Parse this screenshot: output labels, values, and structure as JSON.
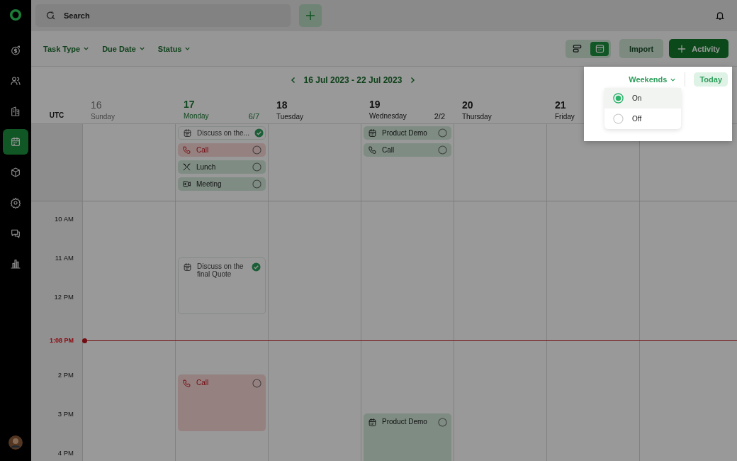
{
  "sidebar": {
    "items": [
      {
        "kind": "deals",
        "selected": false
      },
      {
        "kind": "contacts",
        "selected": false
      },
      {
        "kind": "companies",
        "selected": false
      },
      {
        "kind": "calendar",
        "selected": true
      },
      {
        "kind": "products",
        "selected": false
      },
      {
        "kind": "settings",
        "selected": false
      },
      {
        "kind": "chat",
        "selected": false
      },
      {
        "kind": "reports",
        "selected": false
      }
    ]
  },
  "topbar": {
    "search": {
      "placeholder": "Search"
    }
  },
  "filters": [
    "Task Type",
    "Due Date",
    "Status"
  ],
  "view_toggle": [
    {
      "kind": "list",
      "selected": false
    },
    {
      "kind": "calendar",
      "selected": true
    }
  ],
  "buttons": {
    "import": "Import",
    "activity": "Activity"
  },
  "calendar": {
    "range": "16 Jul 2023 - 22 Jul 2023",
    "timezone": "UTC",
    "days": [
      {
        "date": "16",
        "weekday": "Sunday",
        "past": true,
        "selected": false
      },
      {
        "date": "17",
        "weekday": "Monday",
        "past": false,
        "selected": true,
        "count": "6/7",
        "all_day": [
          {
            "kind": "task",
            "overdue": false,
            "title": "Discuss on the...",
            "done": true
          },
          {
            "kind": "call",
            "overdue": true,
            "title": "Call",
            "done": false
          },
          {
            "kind": "lunch",
            "overdue": false,
            "title": "Lunch",
            "done": false
          },
          {
            "kind": "meeting",
            "overdue": false,
            "title": "Meeting",
            "done": false
          }
        ],
        "events": [
          {
            "kind": "task",
            "overdue": false,
            "title": "Discuss on the final Quote",
            "done": true
          },
          {
            "kind": "call",
            "overdue": true,
            "title": "Call",
            "done": false
          }
        ]
      },
      {
        "date": "18",
        "weekday": "Tuesday",
        "past": false,
        "selected": false
      },
      {
        "date": "19",
        "weekday": "Wednesday",
        "past": false,
        "selected": false,
        "count": "2/2",
        "all_day": [
          {
            "kind": "demo",
            "overdue": false,
            "title": "Product Demo",
            "done": false
          },
          {
            "kind": "call",
            "overdue": false,
            "title": "Call",
            "done": false
          }
        ],
        "events": [
          {
            "kind": "demo",
            "overdue": false,
            "title": "Product Demo",
            "done": false
          }
        ]
      },
      {
        "date": "20",
        "weekday": "Thursday",
        "past": false,
        "selected": false
      },
      {
        "date": "21",
        "weekday": "Friday",
        "past": false,
        "selected": false
      }
    ],
    "hours": [
      "10 AM",
      "11 AM",
      "12 PM",
      "2 PM",
      "3 PM",
      "4 PM"
    ],
    "now": {
      "label": "1:08 PM"
    }
  },
  "weekends_popover": {
    "label": "Weekends",
    "today": "Today",
    "options": [
      {
        "label": "On",
        "selected": true
      },
      {
        "label": "Off",
        "selected": false
      }
    ]
  }
}
